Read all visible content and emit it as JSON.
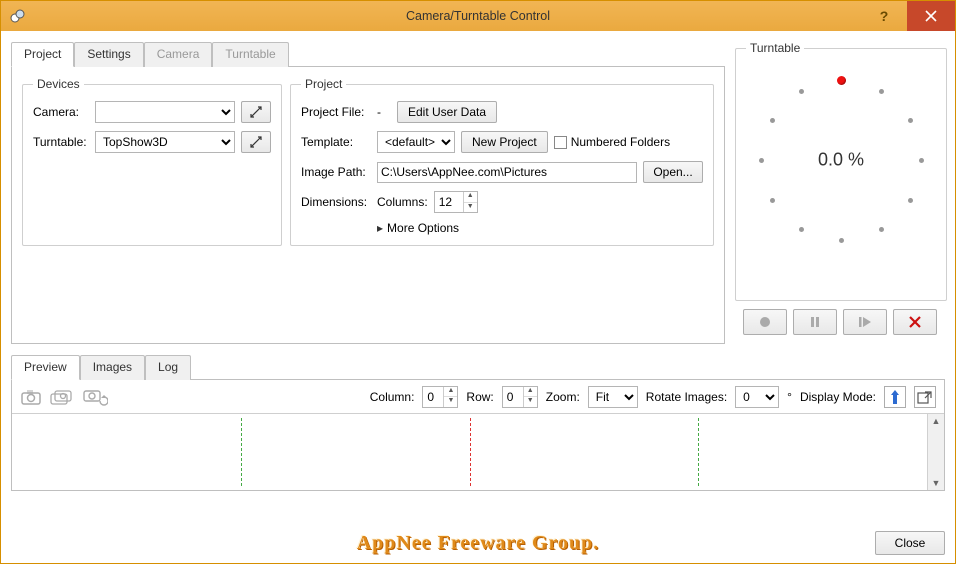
{
  "window": {
    "title": "Camera/Turntable Control"
  },
  "tabs": {
    "main": [
      "Project",
      "Settings",
      "Camera",
      "Turntable"
    ],
    "selected": 0,
    "disabled": [
      2,
      3
    ]
  },
  "devices": {
    "legend": "Devices",
    "camera_label": "Camera:",
    "camera_value": "",
    "turntable_label": "Turntable:",
    "turntable_value": "TopShow3D"
  },
  "project": {
    "legend": "Project",
    "file_label": "Project File:",
    "file_value": "-",
    "edit_user_data": "Edit User Data",
    "template_label": "Template:",
    "template_value": "<default>",
    "new_project": "New Project",
    "numbered_folders": "Numbered Folders",
    "image_path_label": "Image Path:",
    "image_path_value": "C:\\Users\\AppNee.com\\Pictures",
    "open": "Open...",
    "dimensions_label": "Dimensions:",
    "columns_label": "Columns:",
    "columns_value": "12",
    "more_options": "More Options"
  },
  "turntable": {
    "legend": "Turntable",
    "percent": "0.0 %"
  },
  "bottom_tabs": {
    "items": [
      "Preview",
      "Images",
      "Log"
    ],
    "selected": 0
  },
  "preview": {
    "column_label": "Column:",
    "column_value": "0",
    "row_label": "Row:",
    "row_value": "0",
    "zoom_label": "Zoom:",
    "zoom_value": "Fit",
    "rotate_label": "Rotate Images:",
    "rotate_value": "0",
    "degree": "°",
    "display_mode_label": "Display Mode:"
  },
  "footer": {
    "close": "Close",
    "watermark": "AppNee Freeware Group."
  }
}
